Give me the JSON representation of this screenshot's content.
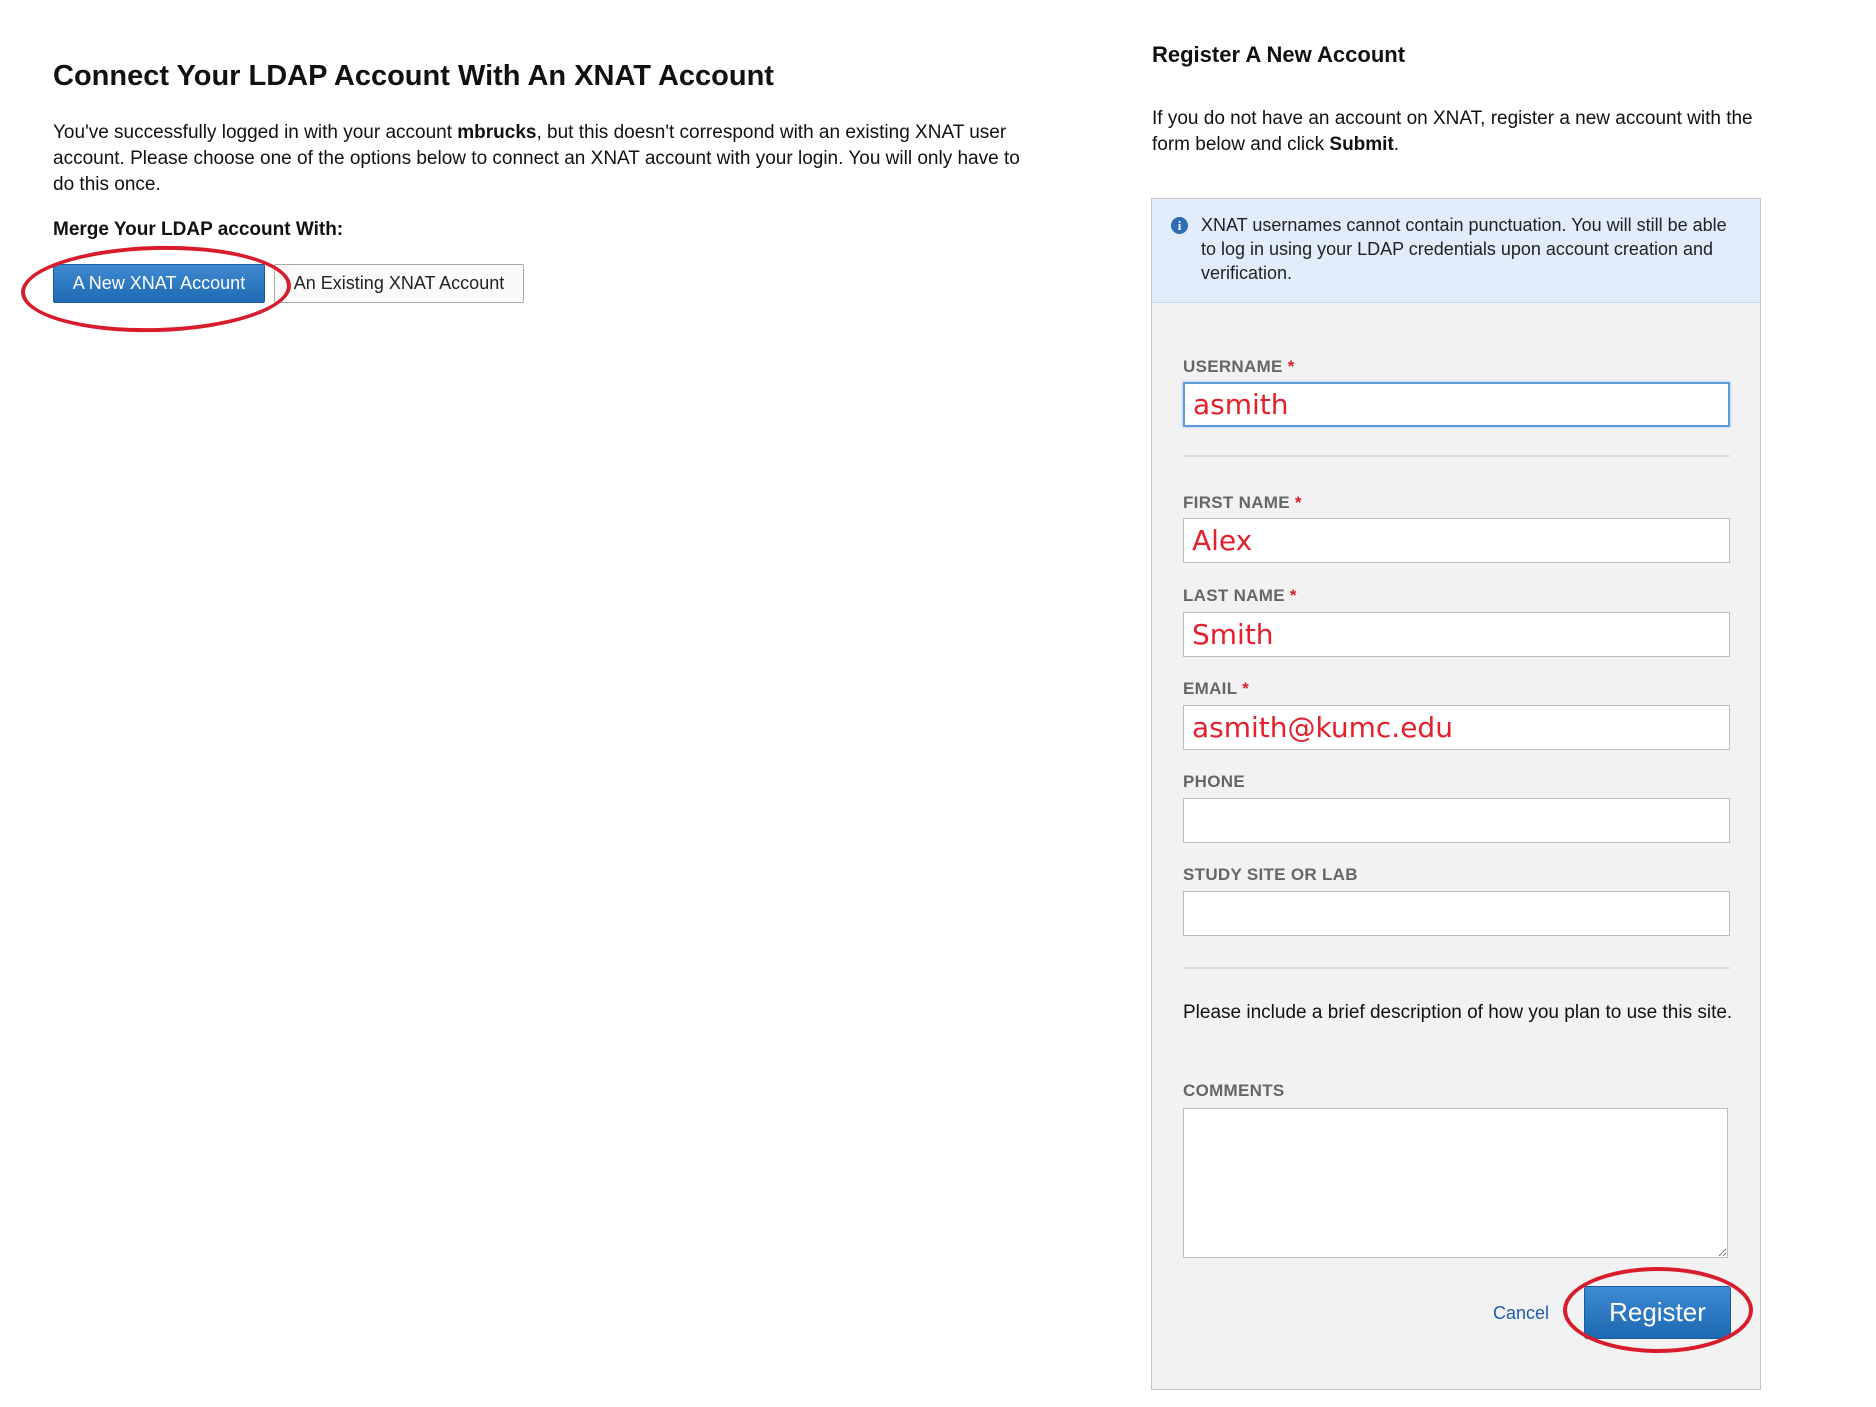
{
  "left": {
    "title": "Connect Your LDAP Account With An XNAT Account",
    "intro_before": "You've successfully logged in with your account ",
    "intro_account": "mbrucks",
    "intro_after": ", but this doesn't correspond with an existing XNAT user account. Please choose one of the options below to connect an XNAT account with your login. You will only have to do this once.",
    "merge_label": "Merge Your LDAP account With:",
    "btn_new": "A New XNAT Account",
    "btn_existing": "An Existing XNAT Account"
  },
  "register": {
    "title": "Register A New Account",
    "intro_before": "If you do not have an account on XNAT, register a new account with the form below and click ",
    "intro_submit": "Submit",
    "intro_after": ".",
    "info": "XNAT usernames cannot contain punctuation. You will still be able to log in using your LDAP credentials upon account creation and verification.",
    "required_mark": "*",
    "fields": {
      "username": {
        "label": "USERNAME",
        "value": "asmith"
      },
      "first_name": {
        "label": "FIRST NAME",
        "value": "Alex"
      },
      "last_name": {
        "label": "LAST NAME",
        "value": "Smith"
      },
      "email": {
        "label": "EMAIL",
        "value": "asmith@kumc.edu"
      },
      "phone": {
        "label": "PHONE",
        "value": ""
      },
      "lab": {
        "label": "STUDY SITE OR LAB",
        "value": ""
      }
    },
    "description": "Please include a brief description of how you plan to use this site.",
    "comments_label": "COMMENTS",
    "cancel": "Cancel",
    "submit": "Register"
  },
  "colors": {
    "accent_blue": "#1e6bb4",
    "highlight_red": "#d81c2b",
    "info_background": "#e1edfb"
  }
}
